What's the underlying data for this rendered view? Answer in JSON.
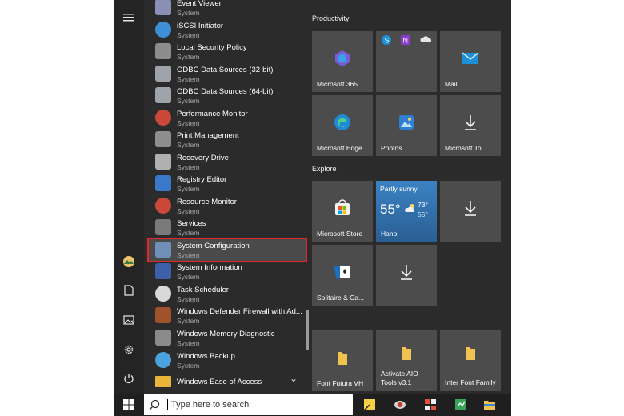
{
  "apps": [
    {
      "name": "Event Viewer",
      "sub": "System",
      "icon": "event-viewer-icon",
      "color": "#8a8fb5",
      "y": -4
    },
    {
      "name": "iSCSI Initiator",
      "sub": "System",
      "icon": "globe-icon",
      "color": "#3e8fd6"
    },
    {
      "name": "Local Security Policy",
      "sub": "System",
      "icon": "security-policy-icon",
      "color": "#8c8c8c"
    },
    {
      "name": "ODBC Data Sources (32-bit)",
      "sub": "System",
      "icon": "database-icon",
      "color": "#9ea4aa"
    },
    {
      "name": "ODBC Data Sources (64-bit)",
      "sub": "System",
      "icon": "database-icon",
      "color": "#9ea4aa"
    },
    {
      "name": "Performance Monitor",
      "sub": "System",
      "icon": "gauge-icon",
      "color": "#c9483a"
    },
    {
      "name": "Print Management",
      "sub": "System",
      "icon": "printer-icon",
      "color": "#8e8e8e"
    },
    {
      "name": "Recovery Drive",
      "sub": "System",
      "icon": "drive-icon",
      "color": "#b0b0b0"
    },
    {
      "name": "Registry Editor",
      "sub": "System",
      "icon": "registry-icon",
      "color": "#3a78c9"
    },
    {
      "name": "Resource Monitor",
      "sub": "System",
      "icon": "gauge-icon",
      "color": "#c9483a"
    },
    {
      "name": "Services",
      "sub": "System",
      "icon": "gears-icon",
      "color": "#7a7a7a"
    },
    {
      "name": "System Configuration",
      "sub": "System",
      "icon": "system-config-icon",
      "color": "#6f8fb8",
      "selected": true
    },
    {
      "name": "System Information",
      "sub": "System",
      "icon": "info-icon",
      "color": "#3d5fa8"
    },
    {
      "name": "Task Scheduler",
      "sub": "System",
      "icon": "clock-icon",
      "color": "#d9d9d9"
    },
    {
      "name": "Windows Defender Firewall with Ad...",
      "sub": "System",
      "icon": "firewall-icon",
      "color": "#a0522d"
    },
    {
      "name": "Windows Memory Diagnostic",
      "sub": "System",
      "icon": "memory-chip-icon",
      "color": "#8a8a8a"
    },
    {
      "name": "Windows Backup",
      "sub": "System",
      "icon": "backup-icon",
      "color": "#4aa3df"
    },
    {
      "name": "Windows Ease of Access",
      "sub": "",
      "icon": "folder-icon",
      "color": "#e8b43a"
    }
  ],
  "groups": {
    "productivity": "Productivity",
    "explore": "Explore"
  },
  "tiles": {
    "microsoft365": "Microsoft 365...",
    "mail": "Mail",
    "edge": "Microsoft Edge",
    "photos": "Photos",
    "todo": "Microsoft To...",
    "store": "Microsoft Store",
    "weather": {
      "condition": "Partly sunny",
      "temp": "55°",
      "high": "73°",
      "low": "55°",
      "city": "Hanoi"
    },
    "solitaire": "Solitaire & Ca...",
    "font_futura": "Font Futura VH",
    "activate": "Activate AIO Tools v3.1",
    "inter": "Inter Font Family"
  },
  "search": {
    "placeholder": "Type here to search"
  },
  "colors": {
    "tile": "#4c4c4c",
    "menu": "#2b2b2b",
    "selection_outline": "#e3262a",
    "weather": "#2f6fa8"
  }
}
